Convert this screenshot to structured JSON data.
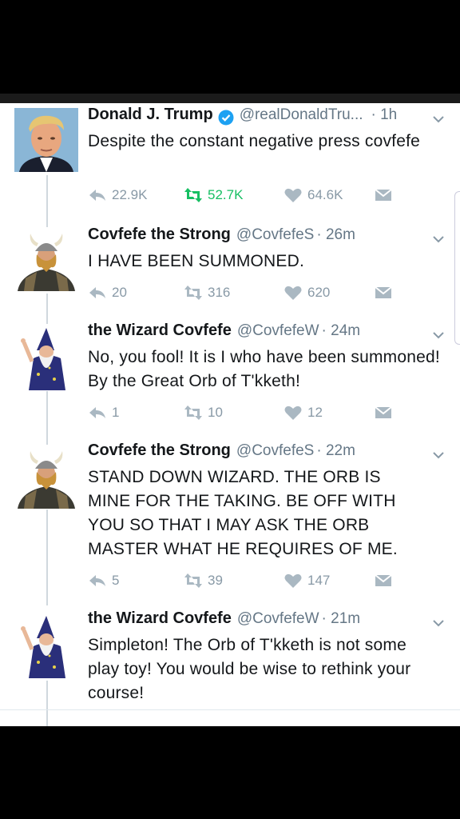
{
  "tweets": [
    {
      "name": "Donald J. Trump",
      "verified": true,
      "handle": "@realDonaldTru...",
      "time": "· 1h",
      "text": "Despite the constant negative press covfefe",
      "replies": "22.9K",
      "retweets": "52.7K",
      "likes": "64.6K",
      "retweeted": true,
      "avatar": "trump-avatar"
    },
    {
      "name": "Covfefe the Strong",
      "verified": false,
      "handle": "@CovfefeS",
      "time": "· 26m",
      "text": "I HAVE BEEN SUMMONED.",
      "replies": "20",
      "retweets": "316",
      "likes": "620",
      "avatar": "viking-avatar"
    },
    {
      "name": "the Wizard Covfefe",
      "verified": false,
      "handle": "@CovfefeW",
      "time": "· 24m",
      "text": "No, you fool! It is I who have been summoned! By the Great Orb of T'kketh!",
      "replies": "1",
      "retweets": "10",
      "likes": "12",
      "avatar": "wizard-avatar"
    },
    {
      "name": "Covfefe the Strong",
      "verified": false,
      "handle": "@CovfefeS",
      "time": "· 22m",
      "text": "STAND DOWN WIZARD. THE ORB IS MINE FOR THE TAKING. BE OFF WITH YOU SO THAT I MAY ASK THE ORB MASTER WHAT HE REQUIRES OF ME.",
      "replies": "5",
      "retweets": "39",
      "likes": "147",
      "avatar": "viking-avatar"
    },
    {
      "name": "the Wizard Covfefe",
      "verified": false,
      "handle": "@CovfefeW",
      "time": "· 21m",
      "text": "Simpleton! The Orb of T'kketh is not some play toy! You would be wise to rethink your course!",
      "avatar": "wizard-avatar"
    }
  ],
  "colors": {
    "name": "#14171a",
    "handle": "#657786",
    "action": "#8899a6",
    "retweet_active": "#17bf63",
    "verified": "#1da1f2"
  }
}
